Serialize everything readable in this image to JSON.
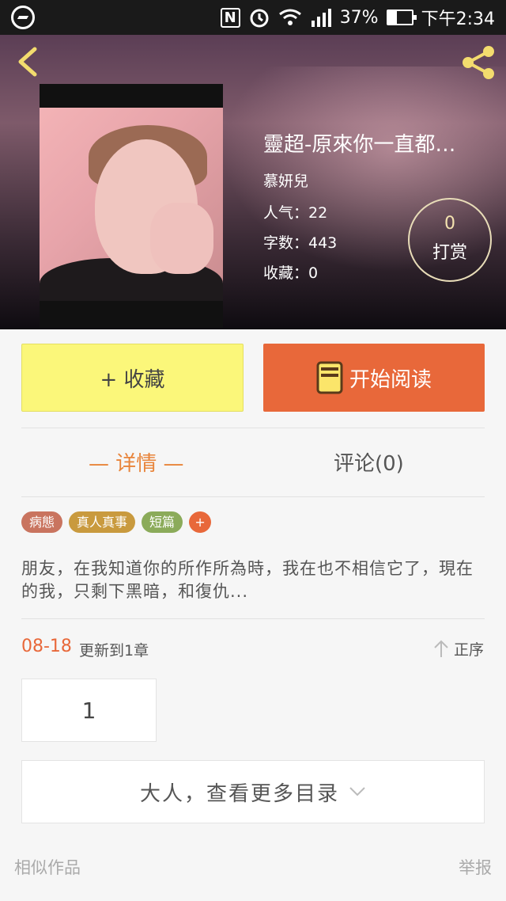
{
  "status_bar": {
    "battery": "37%",
    "battery_level": 0.37,
    "time": "下午2:34",
    "icons": [
      "messenger-icon",
      "nfc-icon",
      "alarm-icon",
      "wifi-icon",
      "signal-icon",
      "battery-icon"
    ]
  },
  "book": {
    "title": "靈超-原來你一直都…",
    "author": "慕妍兒",
    "popularity": "人气：22",
    "words": "字数：443",
    "favorites": "收藏：0",
    "tip_count": "0",
    "tip_label": "打赏"
  },
  "actions": {
    "favorite_label": "+ 收藏",
    "read_label": "开始阅读"
  },
  "tabs": {
    "detail": "— 详情 —",
    "comments": "评论(0)"
  },
  "tags": [
    {
      "label": "病態",
      "color": "#c9745f"
    },
    {
      "label": "真人真事",
      "color": "#c99a3e"
    },
    {
      "label": "短篇",
      "color": "#8bab5a"
    }
  ],
  "tag_add": "+",
  "description": "朋友，在我知道你的所作所為時，我在也不相信它了，現在的我，只剩下黑暗，和復仇...",
  "chapters": {
    "date": "08-18",
    "update_text": "更新到1章",
    "sort_label": "正序",
    "first_chapter": "1",
    "more_label": "大人，查看更多目录"
  },
  "footer": {
    "similar": "相似作品",
    "report": "举报"
  },
  "colors": {
    "accent": "#e8683a",
    "favorite_bg": "#fbf77a",
    "detail_tab": "#e8843a"
  }
}
